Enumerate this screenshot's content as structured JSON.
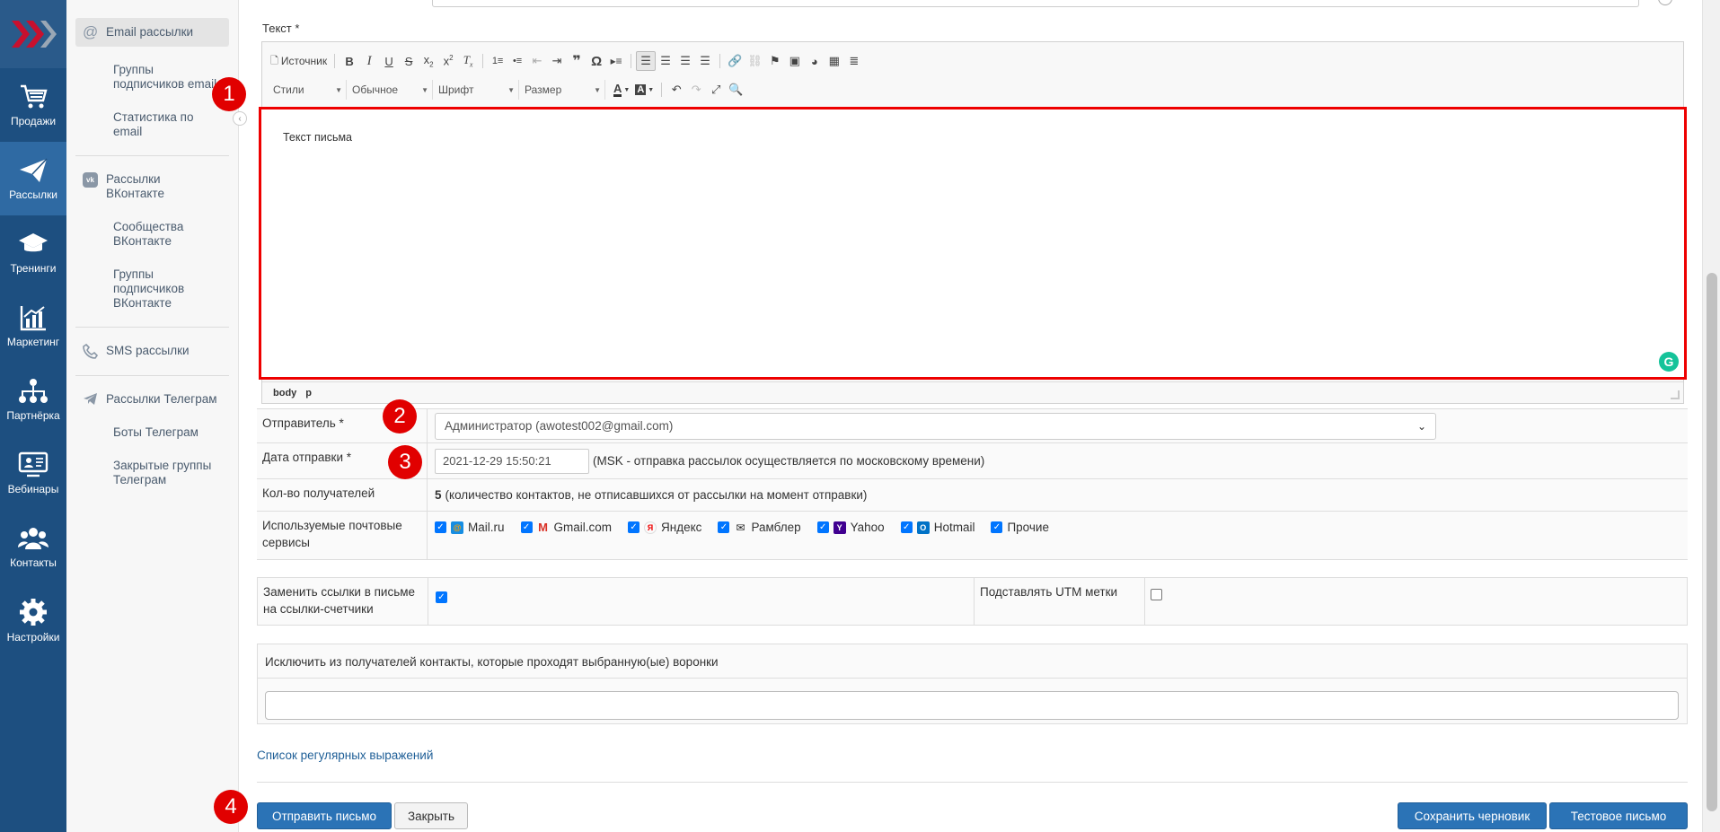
{
  "rail": {
    "items": [
      {
        "label": "Продажи",
        "icon": "cart-icon"
      },
      {
        "label": "Рассылки",
        "icon": "paper-plane-icon",
        "active": true
      },
      {
        "label": "Тренинги",
        "icon": "graduation-cap-icon"
      },
      {
        "label": "Маркетинг",
        "icon": "chart-icon"
      },
      {
        "label": "Партнёрка",
        "icon": "network-icon"
      },
      {
        "label": "Вебинары",
        "icon": "presentation-icon"
      },
      {
        "label": "Контакты",
        "icon": "users-icon"
      },
      {
        "label": "Настройки",
        "icon": "gear-icon"
      }
    ]
  },
  "sidebar": {
    "email": {
      "title": "Email рассылки",
      "sub1": "Группы подписчиков email",
      "sub2": "Статистика по email"
    },
    "vk": {
      "title": "Рассылки ВКонтакте",
      "sub1": "Сообщества ВКонтакте",
      "sub2": "Группы подписчиков ВКонтакте"
    },
    "sms": {
      "title": "SMS рассылки"
    },
    "tg": {
      "title": "Рассылки Телеграм",
      "sub1": "Боты Телеграм",
      "sub2": "Закрытые группы Телеграм"
    }
  },
  "editor": {
    "label": "Текст *",
    "source_label": "Источник",
    "styles": "Стили",
    "format": "Обычное",
    "font": "Шрифт",
    "size": "Размер",
    "content": "Текст письма",
    "path": [
      "body",
      "p"
    ]
  },
  "form": {
    "sender": {
      "label": "Отправитель *",
      "value": "Администратор (awotest002@gmail.com)"
    },
    "send_date": {
      "label": "Дата отправки *",
      "value": "2021-12-29 15:50:21",
      "note": "(MSK - отправка рассылок осуществляется по московскому времени)"
    },
    "recipients": {
      "label": "Кол-во получателей",
      "count": "5",
      "note": "(количество контактов, не отписавшихся от рассылки на момент отправки)"
    },
    "services": {
      "label": "Используемые почтовые сервисы",
      "items": [
        {
          "name": "Mail.ru",
          "checked": true
        },
        {
          "name": "Gmail.com",
          "checked": true
        },
        {
          "name": "Яндекс",
          "checked": true
        },
        {
          "name": "Рамблер",
          "checked": true
        },
        {
          "name": "Yahoo",
          "checked": true
        },
        {
          "name": "Hotmail",
          "checked": true
        },
        {
          "name": "Прочие",
          "checked": true
        }
      ]
    },
    "replace_links": {
      "label": "Заменить ссылки в письме на ссылки-счетчики",
      "checked": true
    },
    "utm": {
      "label": "Подставлять UTM метки",
      "checked": false
    },
    "exclude": {
      "label": "Исключить из получателей контакты, которые проходят выбранную(ые) воронки",
      "value": ""
    },
    "regex_link": "Список регулярных выражений"
  },
  "buttons": {
    "send": "Отправить письмо",
    "close": "Закрыть",
    "save_draft": "Сохранить черновик",
    "test": "Тестовое письмо"
  },
  "badges": [
    "1",
    "2",
    "3",
    "4"
  ],
  "colors": {
    "rail": "#1d4f80",
    "primary": "#2b73b6",
    "highlight": "#e00000"
  }
}
